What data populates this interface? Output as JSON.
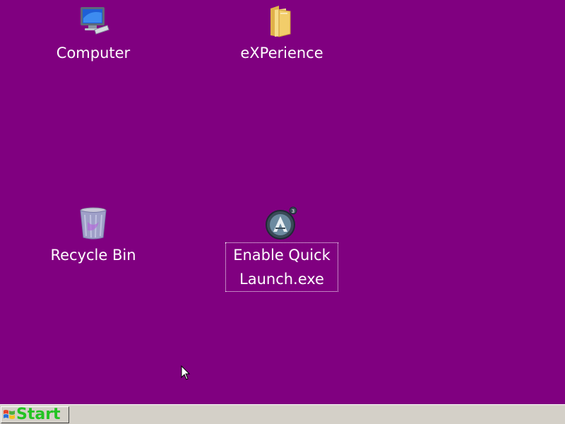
{
  "desktop": {
    "background_color": "#800080",
    "icons": [
      {
        "label": "Computer",
        "icon": "computer-icon"
      },
      {
        "label": "eXPerience",
        "icon": "folder-icon"
      },
      {
        "label": "Recycle Bin",
        "icon": "recycle-bin-icon"
      },
      {
        "label": "Enable Quick Launch.exe",
        "icon": "app-a-icon",
        "selected": true
      }
    ]
  },
  "taskbar": {
    "start_label": "Start",
    "start_label_color": "#22c322",
    "background_color": "#d4d0c8"
  }
}
